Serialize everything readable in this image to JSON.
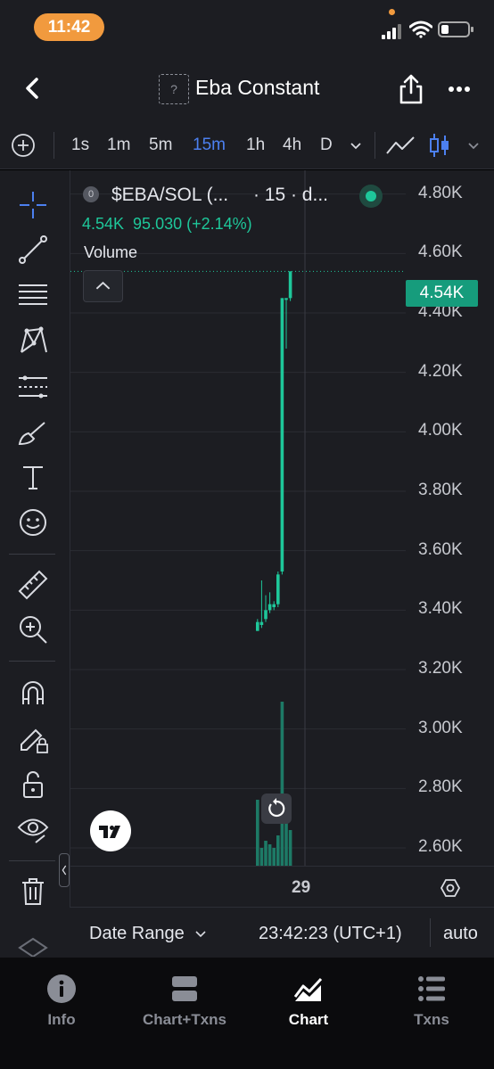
{
  "status_bar": {
    "time": "11:42"
  },
  "header": {
    "title": "Eba Constant",
    "token_placeholder": "?"
  },
  "timeframes": {
    "items": [
      "1s",
      "1m",
      "5m",
      "15m",
      "1h",
      "4h",
      "D"
    ],
    "active": "15m"
  },
  "legend": {
    "badge": "0",
    "symbol": "$EBA/SOL (...",
    "interval": "· 15 · d...",
    "value": "4.54K",
    "change": "95.030 (+2.14%)",
    "volume_label": "Volume"
  },
  "price_tag": "4.54K",
  "chart_data": {
    "type": "candlestick",
    "title": "",
    "y_axis_ticks": [
      "4.80K",
      "4.60K",
      "4.40K",
      "4.20K",
      "4.00K",
      "3.80K",
      "3.60K",
      "3.40K",
      "3.20K",
      "3.00K",
      "2.80K",
      "2.60K"
    ],
    "y_range": [
      2540,
      4880
    ],
    "x_axis_ticks": [
      "29"
    ],
    "last_price": 4540,
    "candles": [
      {
        "open": 3360,
        "high": 3370,
        "low": 3330,
        "close": 3330
      },
      {
        "open": 3350,
        "high": 3500,
        "low": 3340,
        "close": 3360
      },
      {
        "open": 3370,
        "high": 3450,
        "low": 3360,
        "close": 3400
      },
      {
        "open": 3400,
        "high": 3460,
        "low": 3390,
        "close": 3420
      },
      {
        "open": 3410,
        "high": 3430,
        "low": 3400,
        "close": 3420
      },
      {
        "open": 3420,
        "high": 3530,
        "low": 3410,
        "close": 3520
      },
      {
        "open": 3530,
        "high": 4450,
        "low": 3520,
        "close": 4450
      },
      {
        "open": 4450,
        "high": 4450,
        "low": 4280,
        "close": 4450
      },
      {
        "open": 4450,
        "high": 4540,
        "low": 4440,
        "close": 4540
      }
    ],
    "volume": [
      0.37,
      0.1,
      0.14,
      0.12,
      0.1,
      0.17,
      0.92,
      0.3,
      0.2
    ],
    "colors": {
      "up": "#1ec79a",
      "down": "#1ec79a",
      "volume": "#1d7a66",
      "grid": "#2a2c33"
    }
  },
  "x_axis": {
    "tick": "29"
  },
  "chart_bar": {
    "date_range": "Date Range",
    "clock": "23:42:23 (UTC+1)",
    "scale": "auto"
  },
  "bottom_nav": {
    "items": [
      {
        "label": "Info",
        "icon": "info-icon"
      },
      {
        "label": "Chart+Txns",
        "icon": "split-layout-icon"
      },
      {
        "label": "Chart",
        "icon": "area-chart-icon"
      },
      {
        "label": "Txns",
        "icon": "list-icon"
      }
    ],
    "active": "Chart"
  },
  "colors": {
    "accent": "#4c80f0",
    "positive": "#1ec79a",
    "status_pill": "#f19a3e"
  }
}
